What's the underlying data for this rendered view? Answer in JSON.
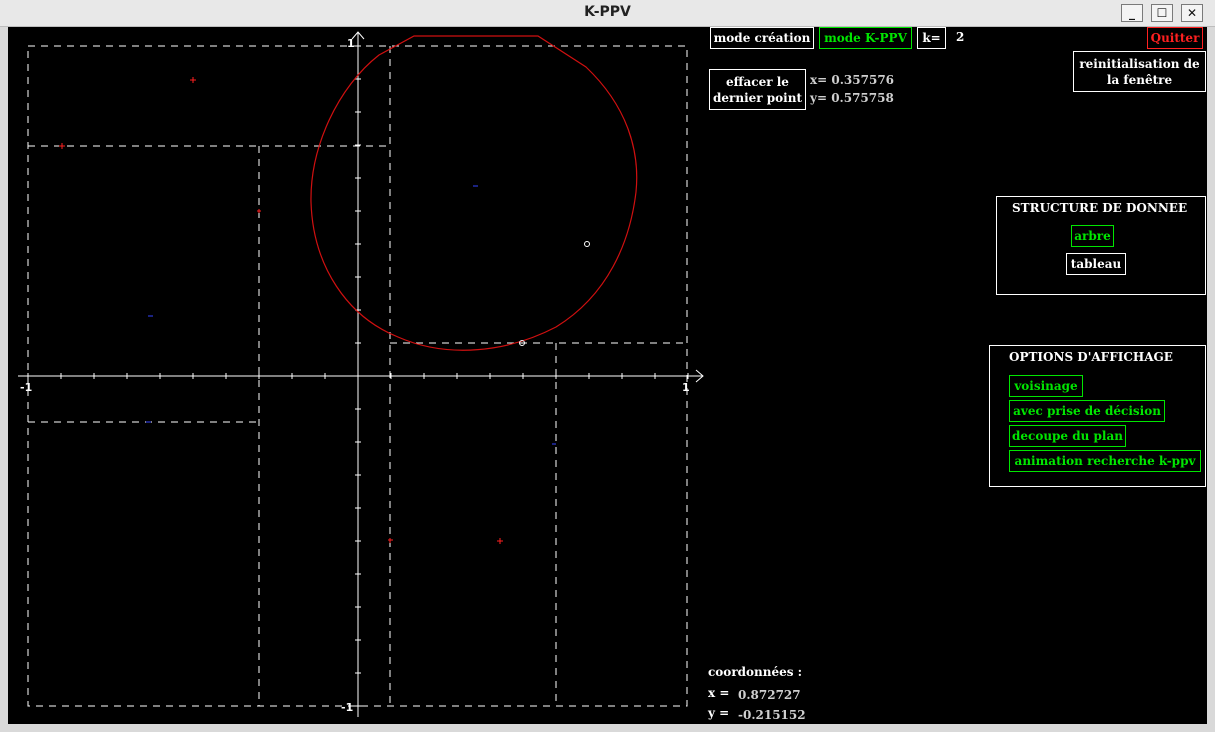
{
  "window": {
    "title": "K-PPV",
    "minimize": "_",
    "maximize": "☐",
    "close": "✕"
  },
  "toolbar": {
    "mode_creation": "mode création",
    "mode_kppv": "mode K-PPV",
    "k_label": "k=",
    "k_value": "2",
    "quit": "Quitter",
    "reset": "reinitialisation de\nla fenêtre",
    "erase_last": "effacer le\ndernier point",
    "cursor_x": "x= 0.357576",
    "cursor_y": "y= 0.575758"
  },
  "structure": {
    "title": "STRUCTURE DE DONNEE",
    "arbre": "arbre",
    "tableau": "tableau"
  },
  "display_options": {
    "title": "OPTIONS D'AFFICHAGE",
    "items": [
      "voisinage",
      "avec prise de décision",
      "decoupe du plan",
      "animation recherche k-ppv"
    ]
  },
  "coordinates": {
    "title": "coordonnées :",
    "x_label": "x =",
    "x_value": "0.872727",
    "y_label": "y =",
    "y_value": "-0.215152"
  },
  "plot": {
    "x_axis_min": "-1",
    "x_axis_max": "1",
    "y_axis_min": "-1",
    "y_axis_max": "1",
    "colors": {
      "class_red": "#ff2020",
      "class_blue": "#3344ff",
      "circle": "#d01010",
      "partition": "#ffffff"
    }
  }
}
